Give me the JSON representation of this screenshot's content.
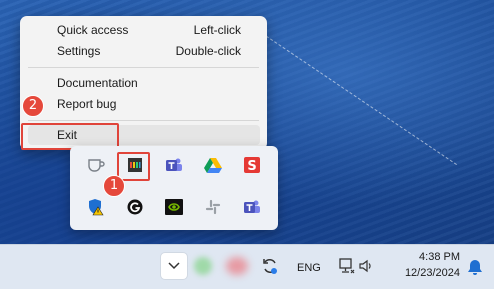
{
  "context_menu": {
    "items": [
      {
        "label": "Quick access",
        "shortcut": "Left-click"
      },
      {
        "label": "Settings",
        "shortcut": "Double-click"
      },
      {
        "label": "Documentation",
        "shortcut": ""
      },
      {
        "label": "Report bug",
        "shortcut": ""
      },
      {
        "label": "Exit",
        "shortcut": ""
      }
    ]
  },
  "annotations": {
    "badge_1": "1",
    "badge_2": "2",
    "highlight_color": "#e0443a"
  },
  "tray_flyout": {
    "icons": [
      "coffee-cup-icon",
      "color-grid-app-icon",
      "teams-icon",
      "google-drive-icon",
      "s-app-icon",
      "windows-security-warning-icon",
      "grammarly-icon",
      "nvidia-icon",
      "slack-icon",
      "teams-icon"
    ]
  },
  "taskbar": {
    "language": "ENG",
    "time": "4:38 PM",
    "date": "12/23/2024",
    "icons": [
      "chevron-up-icon",
      "sync-icon",
      "network-icon",
      "volume-icon",
      "notification-bell-icon"
    ]
  }
}
